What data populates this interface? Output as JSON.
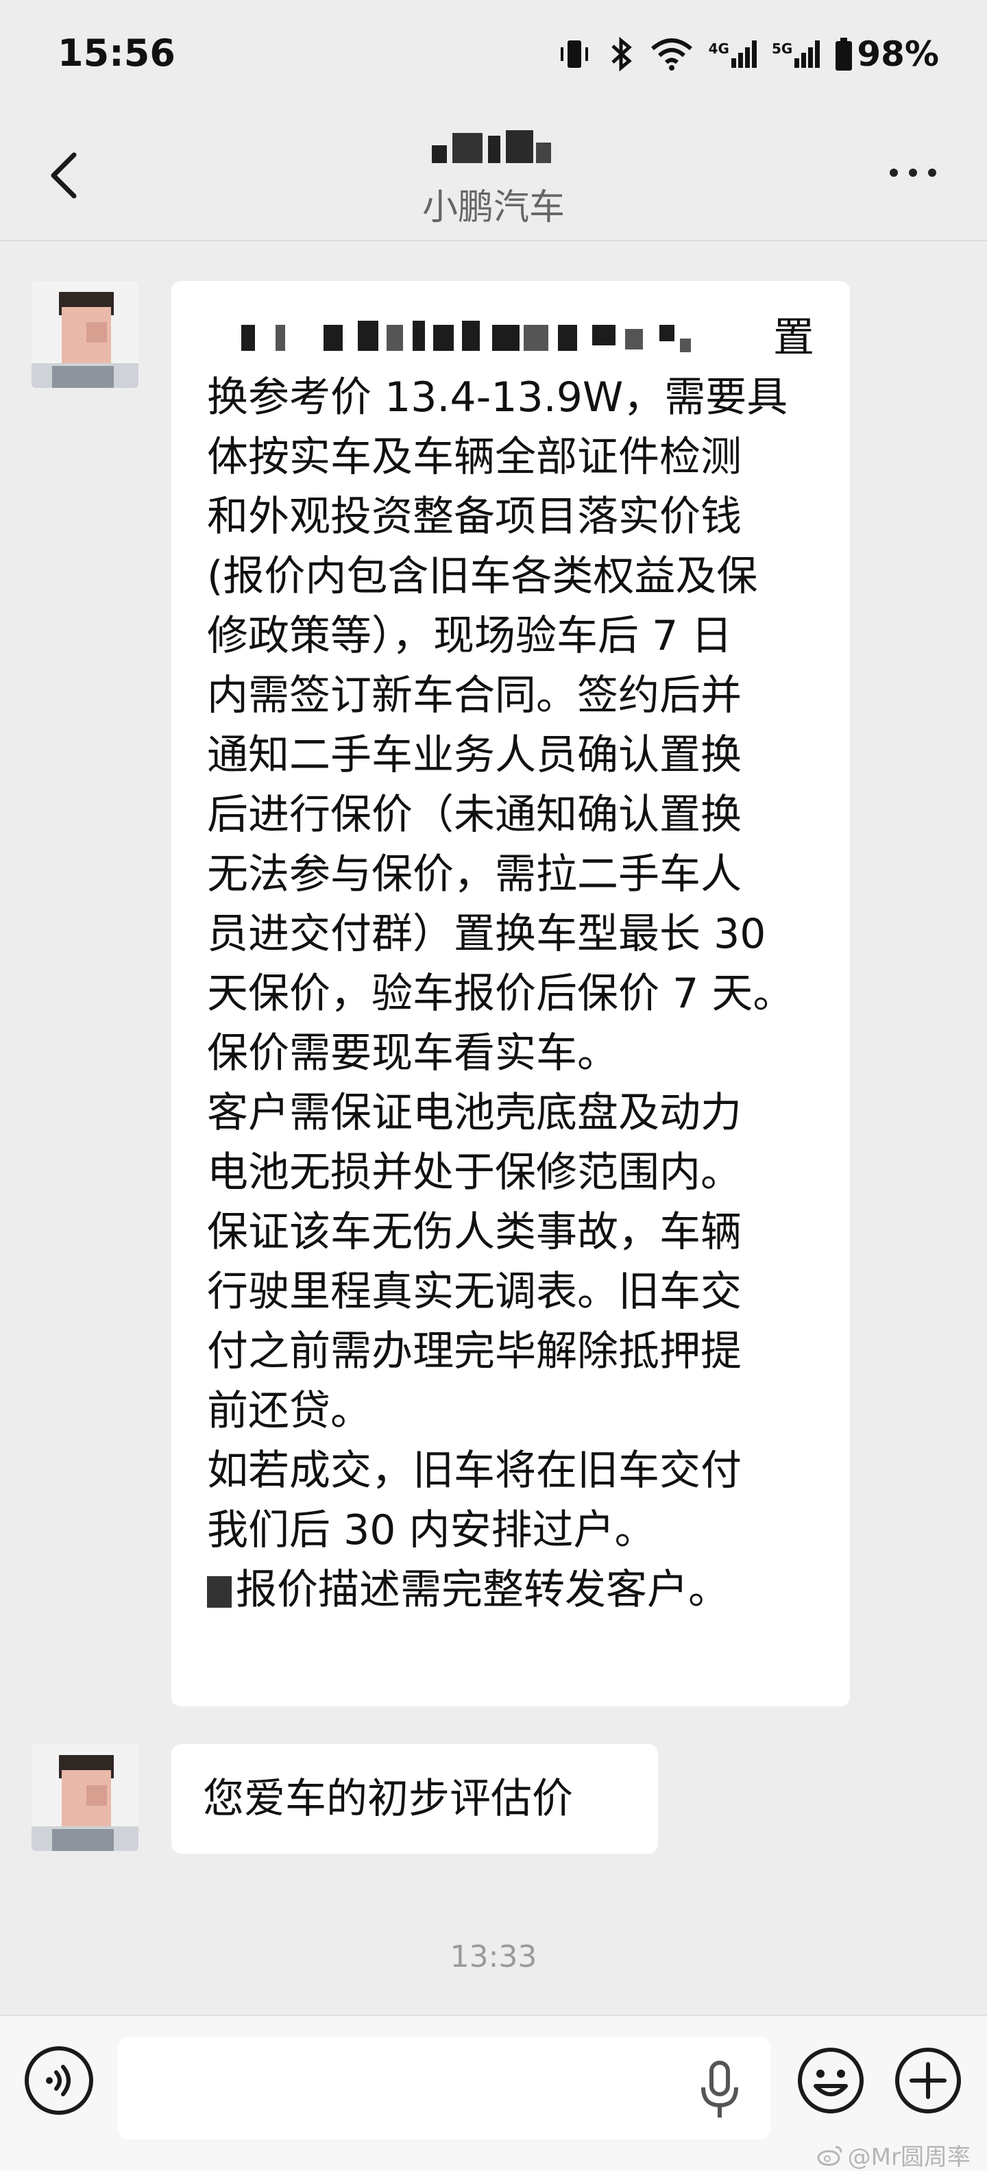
{
  "status_bar": {
    "time": "15:56",
    "network_4g": "4G",
    "network_5g": "5G",
    "battery": "98%"
  },
  "header": {
    "subtitle": "小鹏汽车"
  },
  "messages": [
    {
      "first_line_tail": "置",
      "body": "换参考价 13.4-13.9W，需要具\n体按实车及车辆全部证件检测\n和外观投资整备项目落实价钱\n(报价内包含旧车各类权益及保\n修政策等），现场验车后 7 日\n内需签订新车合同。签约后并\n通知二手车业务人员确认置换\n后进行保价（未通知确认置换\n无法参与保价，需拉二手车人\n员进交付群）置换车型最长 30\n天保价，验车报价后保价 7 天。\n保价需要现车看实车。\n客户需保证电池壳底盘及动力\n电池无损并处于保修范围内。\n保证该车无伤人类事故，车辆\n行驶里程真实无调表。旧车交\n付之前需办理完毕解除抵押提\n前还贷。\n如若成交，旧车将在旧车交付\n我们后 30 内安排过户。\n",
      "last_line": "报价描述需完整转发客户。"
    },
    {
      "body": "您爱车的初步评估价"
    }
  ],
  "timestamp": "13:33",
  "watermark": "@Mr圆周率",
  "icons": {
    "back": "chevron-left-icon",
    "more": "more-dots-icon",
    "voice": "voice-icon",
    "mic": "mic-icon",
    "emoji": "emoji-icon",
    "plus": "plus-icon"
  }
}
